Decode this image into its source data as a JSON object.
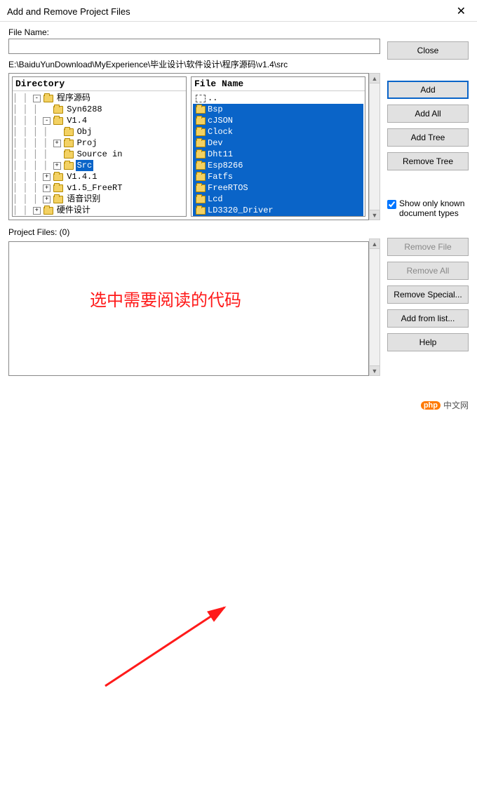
{
  "window": {
    "title": "Add and Remove Project Files",
    "close_glyph": "✕"
  },
  "filename": {
    "label": "File Name:",
    "value": ""
  },
  "path": "E:\\BaiduYunDownload\\MyExperience\\毕业设计\\软件设计\\程序源码\\v1.4\\src",
  "dir_header": "Directory",
  "files_header": "File Name",
  "tree": [
    {
      "indent": 3,
      "expander": "-",
      "label": "程序源码",
      "selected": false
    },
    {
      "indent": 4,
      "expander": "",
      "label": "Syn6288",
      "selected": false
    },
    {
      "indent": 4,
      "expander": "-",
      "label": "V1.4",
      "selected": false
    },
    {
      "indent": 5,
      "expander": "",
      "label": "Obj",
      "selected": false
    },
    {
      "indent": 5,
      "expander": "+",
      "label": "Proj",
      "selected": false
    },
    {
      "indent": 5,
      "expander": "",
      "label": "Source in",
      "selected": false
    },
    {
      "indent": 5,
      "expander": "+",
      "label": "Src",
      "selected": true
    },
    {
      "indent": 4,
      "expander": "+",
      "label": "V1.4.1",
      "selected": false
    },
    {
      "indent": 4,
      "expander": "+",
      "label": "v1.5_FreeRT",
      "selected": false
    },
    {
      "indent": 4,
      "expander": "+",
      "label": "语音识别",
      "selected": false
    },
    {
      "indent": 3,
      "expander": "+",
      "label": "硬件设计",
      "selected": false
    }
  ],
  "files": [
    {
      "label": "..",
      "up": true,
      "selected": false
    },
    {
      "label": "Bsp",
      "selected": true
    },
    {
      "label": "cJSON",
      "selected": true
    },
    {
      "label": "Clock",
      "selected": true
    },
    {
      "label": "Dev",
      "selected": true
    },
    {
      "label": "Dht11",
      "selected": true
    },
    {
      "label": "Esp8266",
      "selected": true
    },
    {
      "label": "Fatfs",
      "selected": true
    },
    {
      "label": "FreeRTOS",
      "selected": true
    },
    {
      "label": "Lcd",
      "selected": true
    },
    {
      "label": "LD3320_Driver",
      "selected": true
    }
  ],
  "project_files": {
    "label": "Project Files: (0)"
  },
  "buttons": {
    "close": "Close",
    "add": "Add",
    "add_all": "Add All",
    "add_tree": "Add Tree",
    "remove_tree": "Remove Tree",
    "remove_file": "Remove File",
    "remove_all": "Remove All",
    "remove_special": "Remove Special...",
    "add_from_list": "Add from list...",
    "help": "Help"
  },
  "checkbox": {
    "checked": true,
    "label": "Show only known document types"
  },
  "annotation": {
    "text": "选中需要阅读的代码"
  },
  "watermark": {
    "badge": "php",
    "text": "中文网"
  }
}
